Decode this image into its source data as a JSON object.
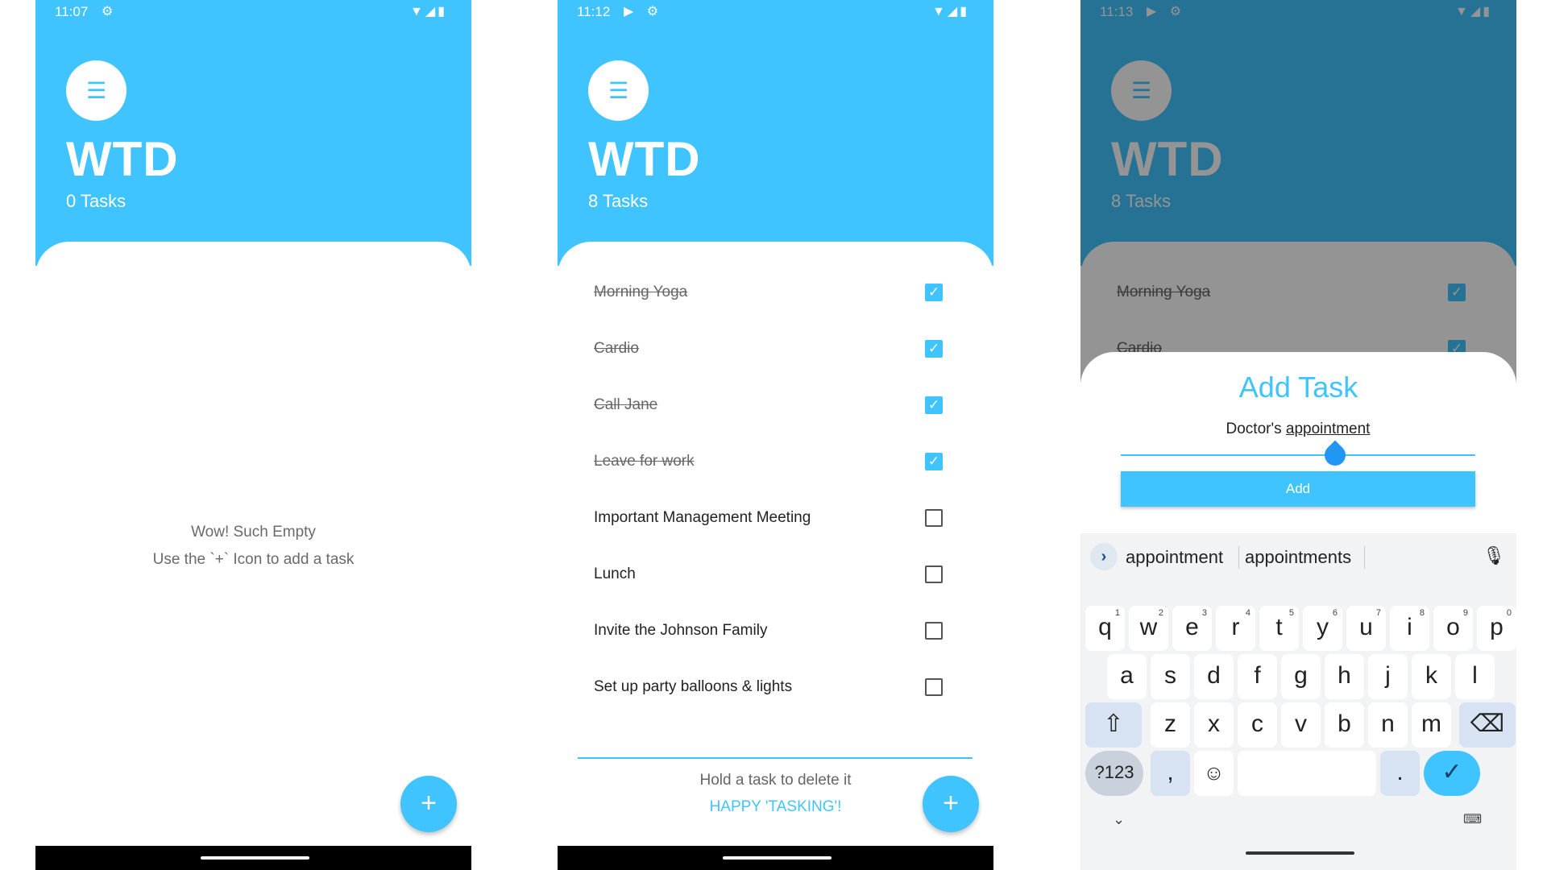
{
  "screens": [
    {
      "status": {
        "time": "11:07",
        "icons": "⚙"
      },
      "app_title": "WTD",
      "task_count": "0 Tasks",
      "empty": {
        "line1": "Wow! Such Empty",
        "line2": "Use the `+` Icon to add a task"
      },
      "fab": "+"
    },
    {
      "status": {
        "time": "11:12",
        "icons": "▶ ⚙"
      },
      "app_title": "WTD",
      "task_count": "8 Tasks",
      "tasks": [
        {
          "label": "Morning Yoga",
          "done": true
        },
        {
          "label": "Cardio",
          "done": true
        },
        {
          "label": "Call Jane",
          "done": true
        },
        {
          "label": "Leave for work",
          "done": true
        },
        {
          "label": "Important Management Meeting",
          "done": false
        },
        {
          "label": "Lunch",
          "done": false
        },
        {
          "label": "Invite the Johnson Family",
          "done": false
        },
        {
          "label": "Set up party balloons & lights",
          "done": false
        }
      ],
      "footer": {
        "hint": "Hold a task to delete it",
        "tagline": "HAPPY 'TASKING'!"
      },
      "fab": "+"
    },
    {
      "status": {
        "time": "11:13",
        "icons": "▶ ⚙"
      },
      "app_title": "WTD",
      "task_count": "8 Tasks",
      "tasks_visible": [
        "Morning Yoga",
        "Cardio"
      ],
      "dialog": {
        "title": "Add Task",
        "input_text": "Doctor's ",
        "input_underlined": "appointment",
        "button": "Add"
      },
      "keyboard": {
        "suggestions": [
          "appointment",
          "appointments"
        ],
        "row1": [
          {
            "k": "q",
            "n": "1"
          },
          {
            "k": "w",
            "n": "2"
          },
          {
            "k": "e",
            "n": "3"
          },
          {
            "k": "r",
            "n": "4"
          },
          {
            "k": "t",
            "n": "5"
          },
          {
            "k": "y",
            "n": "6"
          },
          {
            "k": "u",
            "n": "7"
          },
          {
            "k": "i",
            "n": "8"
          },
          {
            "k": "o",
            "n": "9"
          },
          {
            "k": "p",
            "n": "0"
          }
        ],
        "row2": [
          "a",
          "s",
          "d",
          "f",
          "g",
          "h",
          "j",
          "k",
          "l"
        ],
        "row3": [
          "z",
          "x",
          "c",
          "v",
          "b",
          "n",
          "m"
        ],
        "shift": "⇧",
        "backspace": "⌫",
        "symbols": "?123",
        "comma": ",",
        "emoji": "☺",
        "period": ".",
        "enter": "✓",
        "hide": "⌄",
        "kb_switch": "⌨"
      }
    }
  ],
  "colors": {
    "accent": "#40c4ff",
    "dim_header": "#1b5672"
  }
}
